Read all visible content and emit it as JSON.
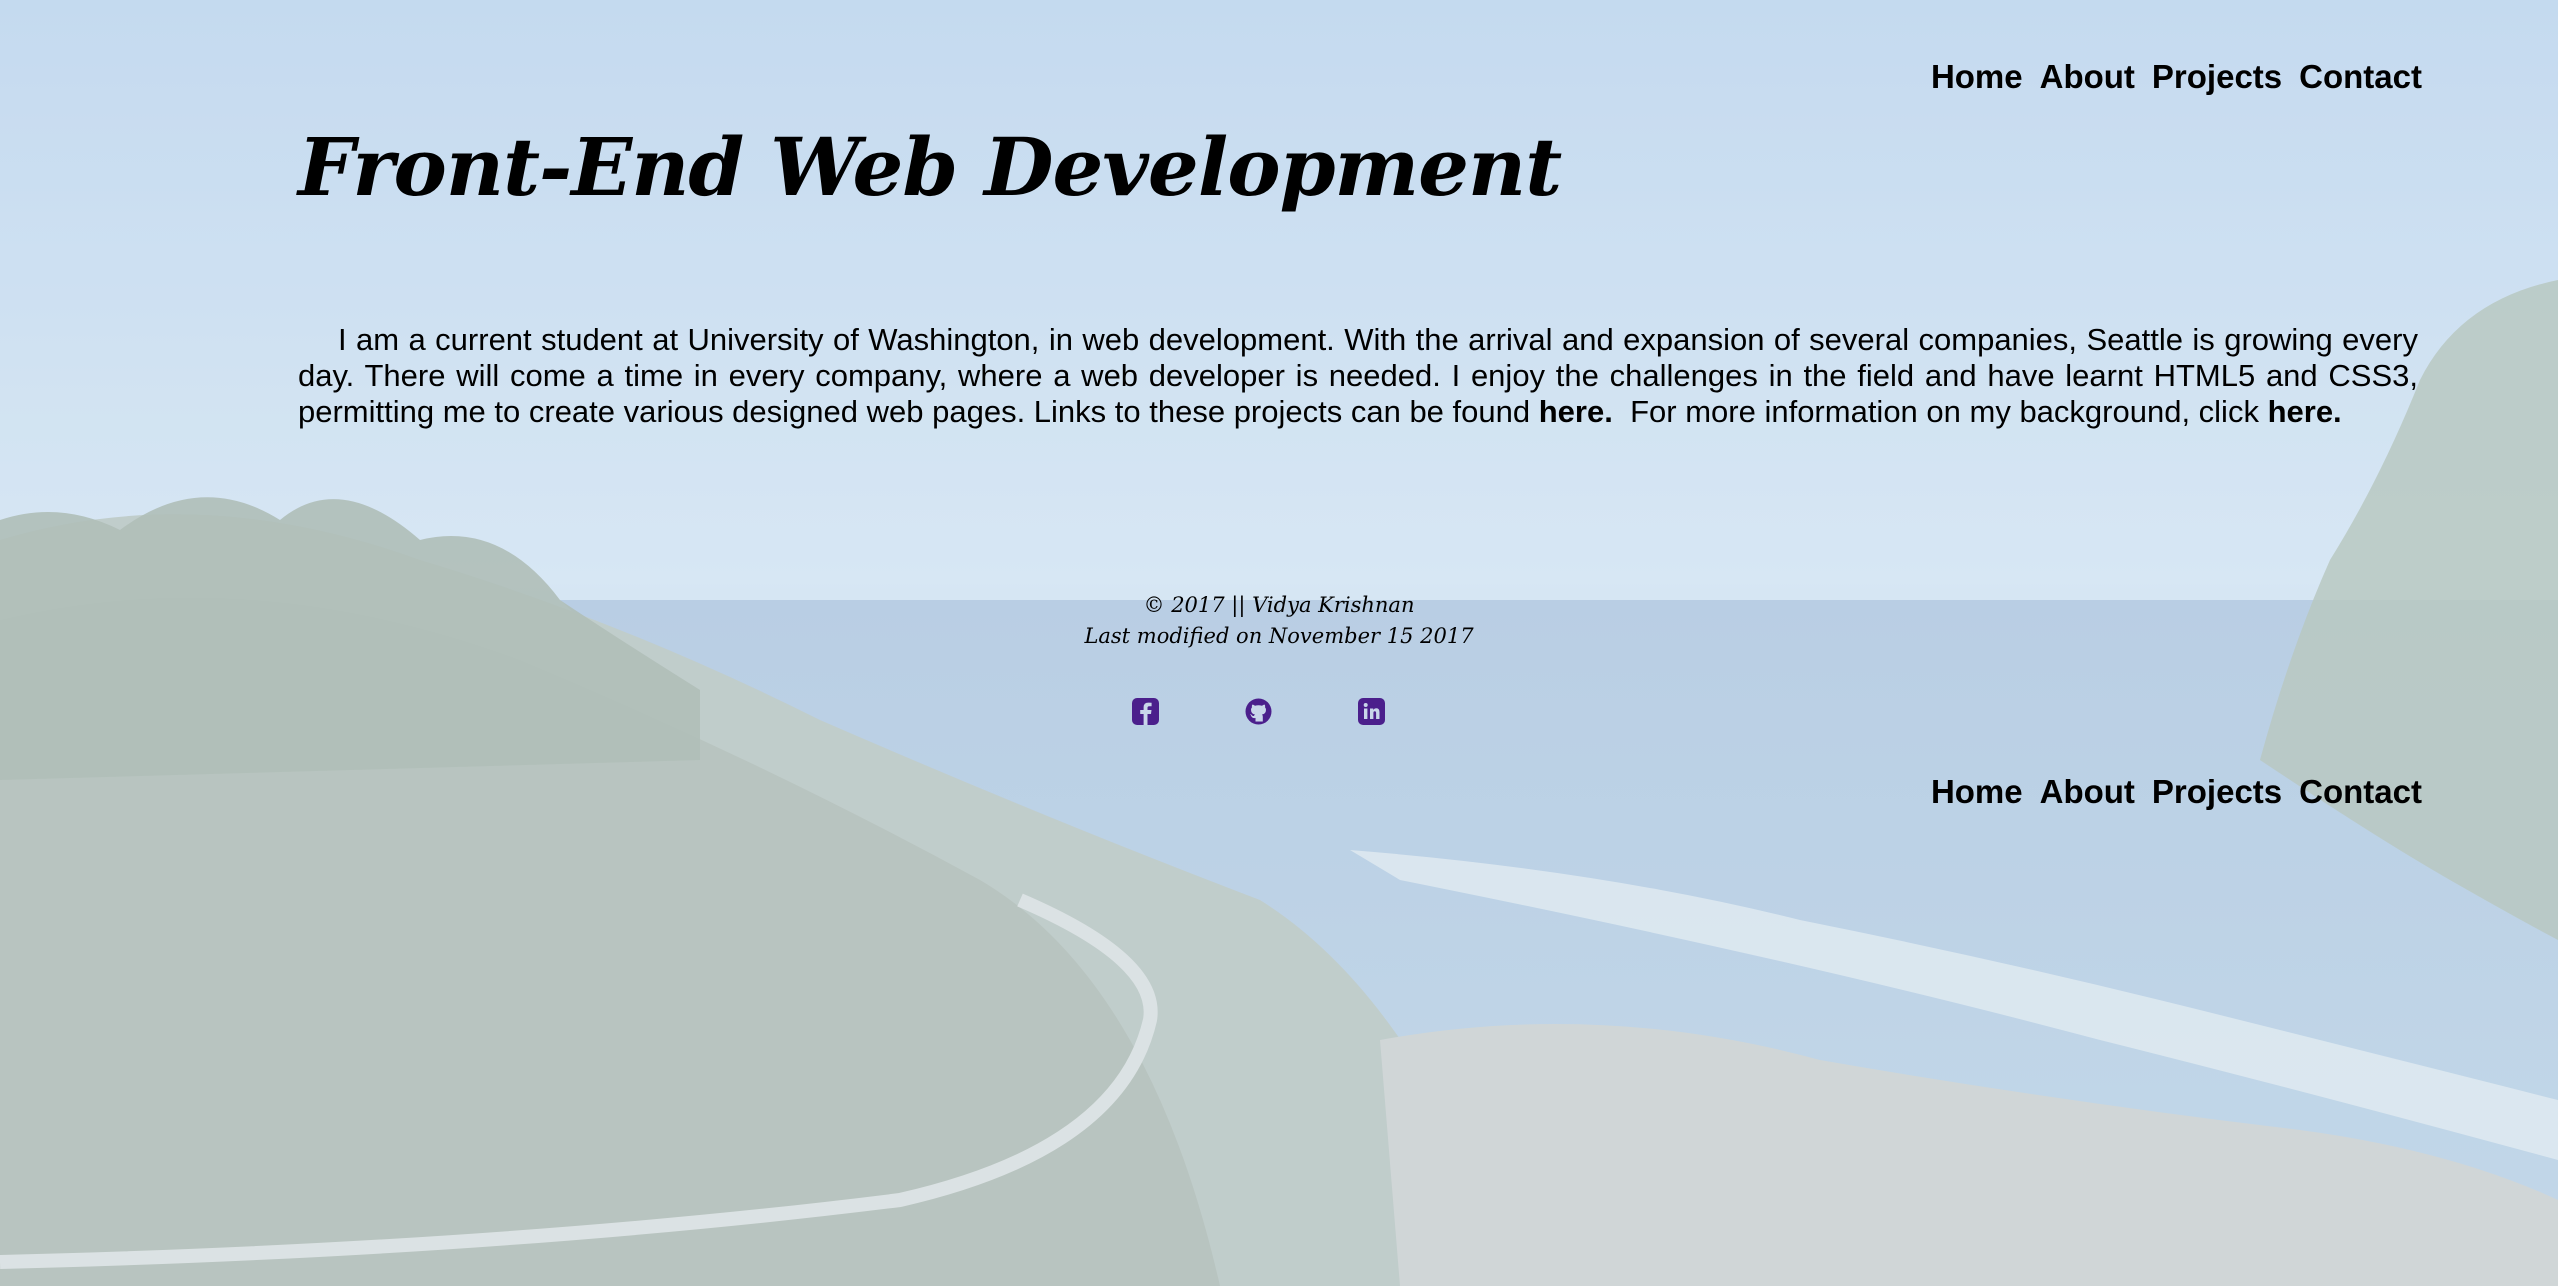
{
  "nav": {
    "items": [
      {
        "label": "Home"
      },
      {
        "label": "About"
      },
      {
        "label": "Projects"
      },
      {
        "label": "Contact"
      }
    ]
  },
  "main": {
    "title": "Front-End Web Development",
    "intro_text": "I am a current student at University of Washington, in web development. With the arrival and expansion of several companies, Seattle is growing every day. There will come a time in every company, where a web developer is needed. I enjoy the challenges in the field and have learnt HTML5 and CSS3, permitting me to create various designed web pages. Links to these projects can be found",
    "projects_link": "here.",
    "intro_text_2": "For more information on my background, click",
    "background_link": "here."
  },
  "footer": {
    "copyright": "© 2017 || Vidya Krishnan",
    "last_modified": "Last modified on November 15 2017",
    "social": [
      {
        "icon": "facebook-icon"
      },
      {
        "icon": "github-icon"
      },
      {
        "icon": "linkedin-icon"
      }
    ]
  },
  "colors": {
    "social_icon": "#4b1f8c",
    "text": "#000000"
  }
}
